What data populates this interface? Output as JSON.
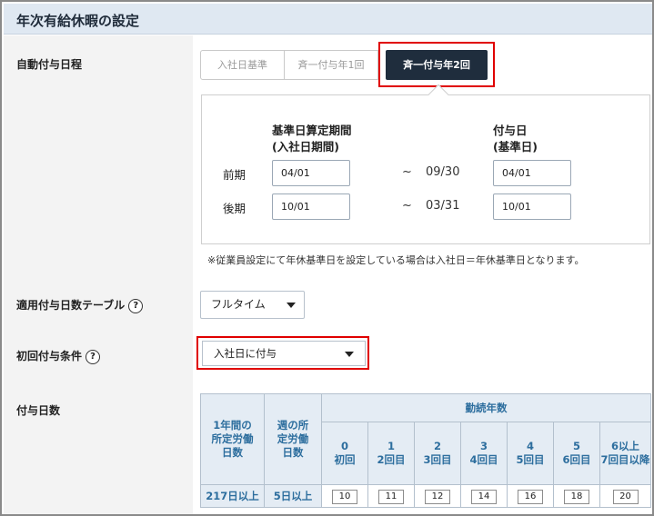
{
  "header": {
    "title": "年次有給休暇の設定"
  },
  "schedule": {
    "label": "自動付与日程",
    "options": [
      "入社日基準",
      "斉一付与年1回",
      "斉一付与年2回"
    ],
    "selected": "斉一付与年2回"
  },
  "panel": {
    "col1_line1": "基準日算定期間",
    "col1_line2": "(入社日期間)",
    "col2_line1": "付与日",
    "col2_line2": "(基準日)",
    "rows": [
      {
        "label": "前期",
        "start": "04/01",
        "tilde": "~",
        "end": "09/30",
        "grant": "04/01"
      },
      {
        "label": "後期",
        "start": "10/01",
        "tilde": "~",
        "end": "03/31",
        "grant": "10/01"
      }
    ]
  },
  "note": "※従業員設定にて年休基準日を設定している場合は入社日＝年休基準日となります。",
  "table_setting": {
    "label": "適用付与日数テーブル",
    "help": "?",
    "value": "フルタイム"
  },
  "first_grant": {
    "label": "初回付与条件",
    "help": "?",
    "value": "入社日に付与"
  },
  "grant_days": {
    "label": "付与日数",
    "col_a": [
      "1年間の",
      "所定労働",
      "日数"
    ],
    "col_b": [
      "週の所",
      "定労働",
      "日数"
    ],
    "years_header": "勤続年数",
    "years": [
      {
        "top": "0",
        "bottom": "初回"
      },
      {
        "top": "1",
        "bottom": "2回目"
      },
      {
        "top": "2",
        "bottom": "3回目"
      },
      {
        "top": "3",
        "bottom": "4回目"
      },
      {
        "top": "4",
        "bottom": "5回目"
      },
      {
        "top": "5",
        "bottom": "6回目"
      },
      {
        "top": "6以上",
        "bottom": "7回目以降"
      }
    ],
    "row": {
      "a": "217日以上",
      "b": "5日以上",
      "values": [
        "10",
        "11",
        "12",
        "14",
        "16",
        "18",
        "20"
      ]
    }
  },
  "colors": {
    "header_bg": "#dfe8f2",
    "selected_bg": "#1f2d3d",
    "highlight": "#e00000",
    "table_text": "#2d6e9e"
  }
}
